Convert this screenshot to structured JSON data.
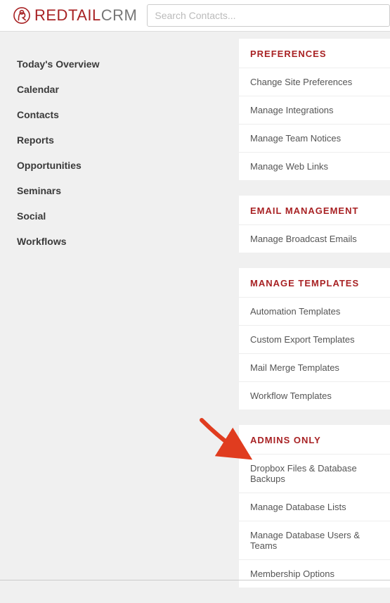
{
  "brand": {
    "name_main": "REDTAIL",
    "name_sub": "CRM"
  },
  "search": {
    "placeholder": "Search Contacts..."
  },
  "sidebar": {
    "items": [
      {
        "label": "Today's Overview"
      },
      {
        "label": "Calendar"
      },
      {
        "label": "Contacts"
      },
      {
        "label": "Reports"
      },
      {
        "label": "Opportunities"
      },
      {
        "label": "Seminars"
      },
      {
        "label": "Social"
      },
      {
        "label": "Workflows"
      }
    ]
  },
  "panels": [
    {
      "title": "PREFERENCES",
      "items": [
        "Change Site Preferences",
        "Manage Integrations",
        "Manage Team Notices",
        "Manage Web Links"
      ]
    },
    {
      "title": "EMAIL MANAGEMENT",
      "items": [
        "Manage Broadcast Emails"
      ]
    },
    {
      "title": "MANAGE TEMPLATES",
      "items": [
        "Automation Templates",
        "Custom Export Templates",
        "Mail Merge Templates",
        "Workflow Templates"
      ]
    },
    {
      "title": "ADMINS ONLY",
      "items": [
        "Dropbox Files & Database Backups",
        "Manage Database Lists",
        "Manage Database Users & Teams",
        "Membership Options"
      ]
    }
  ]
}
